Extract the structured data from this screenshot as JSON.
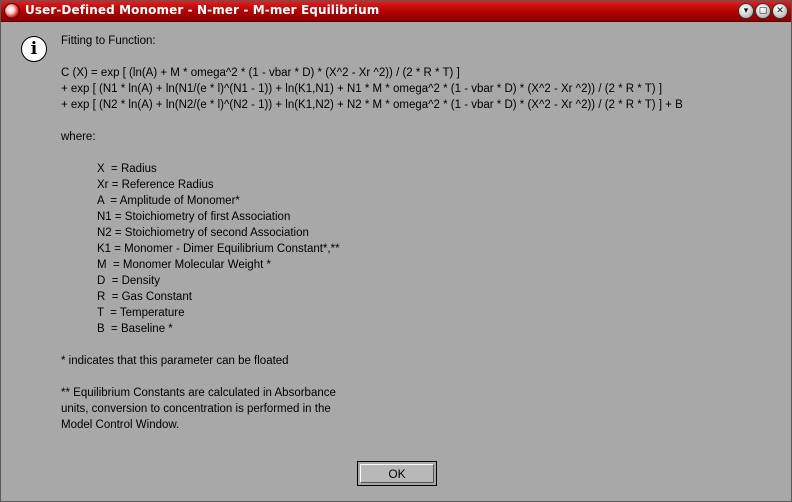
{
  "window": {
    "title": "User-Defined Monomer - N-mer - M-mer Equilibrium",
    "buttons": {
      "minimize": "▾",
      "maximize": "▢",
      "close": "✕"
    }
  },
  "icon": {
    "glyph": "i",
    "name": "info-icon"
  },
  "message": {
    "heading": "Fitting to Function:",
    "equation": [
      "C (X) = exp [ (ln(A) + M * omega^2 * (1 - vbar * D) * (X^2 - Xr ^2)) / (2 * R * T) ]",
      "+ exp [ (N1 * ln(A) + ln(N1/(e * l)^(N1 - 1)) + ln(K1,N1) + N1 * M * omega^2 * (1 - vbar * D) * (X^2 - Xr ^2)) / (2 * R * T) ]",
      "+ exp [ (N2 * ln(A) + ln(N2/(e * l)^(N2 - 1)) + ln(K1,N2) + N2 * M * omega^2 * (1 - vbar * D) * (X^2 - Xr ^2)) / (2 * R * T) ] + B"
    ],
    "where_label": "where:",
    "definitions": [
      "X  = Radius",
      "Xr = Reference Radius",
      "A  = Amplitude of Monomer*",
      "N1 = Stoichiometry of first Association",
      "N2 = Stoichiometry of second Association",
      "K1 = Monomer - Dimer Equilibrium Constant*,**",
      "M  = Monomer Molecular Weight *",
      "D  = Density",
      "R  = Gas Constant",
      "T  = Temperature",
      "B  = Baseline *"
    ],
    "footnote1": "* indicates that this parameter can be floated",
    "footnote2": [
      "** Equilibrium Constants are calculated in Absorbance",
      "units, conversion to concentration is performed in the",
      "Model Control Window."
    ]
  },
  "ok_button": {
    "label": "OK"
  },
  "colors": {
    "titlebar": "#b00000",
    "background": "#a8a8a8",
    "text": "#000000"
  }
}
